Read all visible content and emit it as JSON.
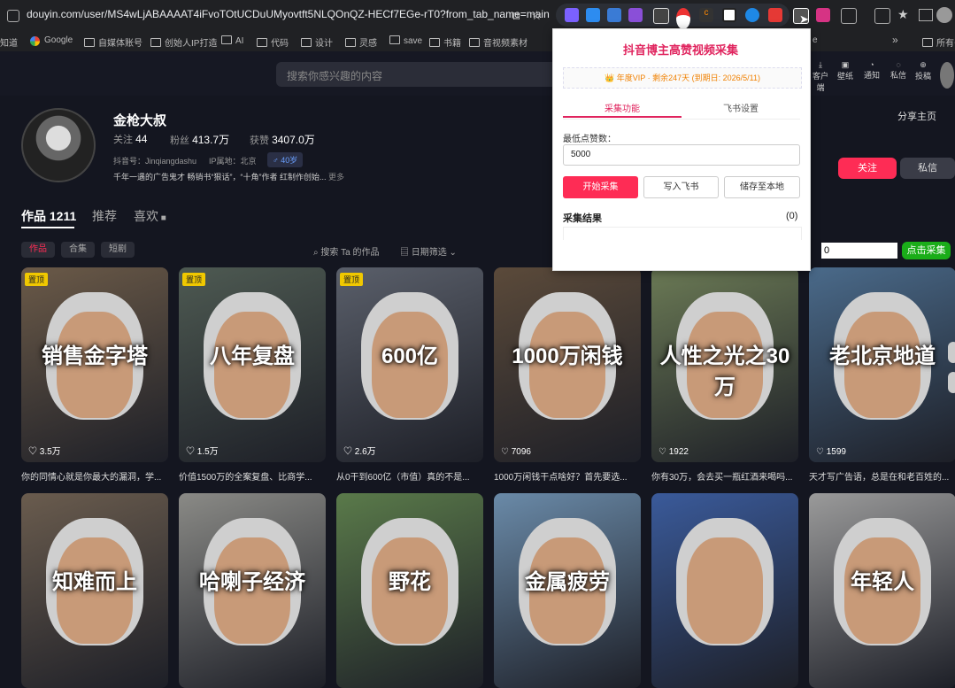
{
  "browser": {
    "url": "douyin.com/user/MS4wLjABAAAAT4iFvoTOtUCDuUMyovtft5NLQOnQZ-HECf7EGe-rT0?from_tab_name=main",
    "bookmarks": [
      "Google",
      "自媒体账号",
      "创始人IP打造",
      "AI",
      "代码",
      "设计",
      "灵感",
      "save",
      "书籍",
      "音视频素材"
    ],
    "bookmark_first": "知道",
    "bookmark_more": "»",
    "bookmark_last": "所有书",
    "bookmark_cut": "e"
  },
  "header": {
    "search_placeholder": "搜索你感兴趣的内容",
    "icons": [
      "客户端",
      "壁纸",
      "通知",
      "私信",
      "投稿"
    ]
  },
  "profile": {
    "name": "金枪大叔",
    "following_label": "关注",
    "following": "44",
    "fans_label": "粉丝",
    "fans": "413.7万",
    "likes_label": "获赞",
    "likes": "3407.0万",
    "douyin_id": "抖音号：Jinqiangdashu",
    "ip": "IP属地：北京",
    "age": "40岁",
    "bio": "千年一遇的广告鬼才 畅销书“狠话”，“十角”作者 红制作创始...",
    "more": "更多",
    "share": "分享主页",
    "follow_btn": "关注",
    "message_btn": "私信"
  },
  "tabs": {
    "works": "作品 1211",
    "recommend": "推荐",
    "liked": "喜欢"
  },
  "filters": {
    "chips": [
      "作品",
      "合集",
      "短剧"
    ],
    "search_label": "搜索 Ta 的作品",
    "date_label": "日期筛选",
    "input_value": "0",
    "collect_btn": "点击采集"
  },
  "videos": [
    {
      "overlay": "销售金字塔",
      "likes": "3.5万",
      "caption": "你的同情心就是你最大的漏洞，学...",
      "pinned": "置顶",
      "bg": "#6b5a48"
    },
    {
      "overlay": "八年复盘",
      "likes": "1.5万",
      "caption": "价值1500万的全案复盘、比商学...",
      "pinned": "置顶",
      "bg": "#4e5a52"
    },
    {
      "overlay": "600亿",
      "likes": "2.6万",
      "caption": "从0干到600亿（市值）真的不是...",
      "pinned": "置顶",
      "bg": "#5a5f6a"
    },
    {
      "overlay": "1000万闲钱",
      "likes": "7096",
      "caption": "1000万闲钱干点啥好？首先要选...",
      "pinned": "",
      "bg": "#5b4a3a"
    },
    {
      "overlay": "人性之光之30万",
      "likes": "1922",
      "caption": "你有30万，会去买一瓶红酒来喝吗...",
      "pinned": "",
      "bg": "#6b7a55"
    },
    {
      "overlay": "老北京地道",
      "likes": "1599",
      "caption": "天才写广告语，总是在和老百姓的...",
      "pinned": "",
      "bg": "#4a6a8a"
    },
    {
      "overlay": "知难而上",
      "likes": "",
      "caption": "",
      "pinned": "",
      "bg": "#6a5c4e"
    },
    {
      "overlay": "哈喇子经济",
      "likes": "",
      "caption": "",
      "pinned": "",
      "bg": "#8a8a86"
    },
    {
      "overlay": "野花",
      "likes": "",
      "caption": "",
      "pinned": "",
      "bg": "#5a7a4a"
    },
    {
      "overlay": "金属疲劳",
      "likes": "",
      "caption": "",
      "pinned": "",
      "bg": "#6a8aa8"
    },
    {
      "overlay": "",
      "likes": "",
      "caption": "",
      "pinned": "",
      "bg": "#3a5a9a"
    },
    {
      "overlay": "年轻人",
      "likes": "",
      "caption": "",
      "pinned": "",
      "bg": "#9a9a9a"
    }
  ],
  "popup": {
    "title": "抖音博主高赞视频采集",
    "vip": "👑 年度VIP · 剩余247天 (到期日: 2026/5/11)",
    "tab_collect": "采集功能",
    "tab_feishu": "飞书设置",
    "min_likes_label": "最低点赞数：",
    "min_likes_value": "5000",
    "btn_start": "开始采集",
    "btn_write": "写入飞书",
    "btn_save": "储存至本地",
    "results_label": "采集结果",
    "results_count": "(0)"
  },
  "colors": {
    "accent": "#fe2c55",
    "popup_title": "#e0245e",
    "collect_green": "#1aad19"
  }
}
